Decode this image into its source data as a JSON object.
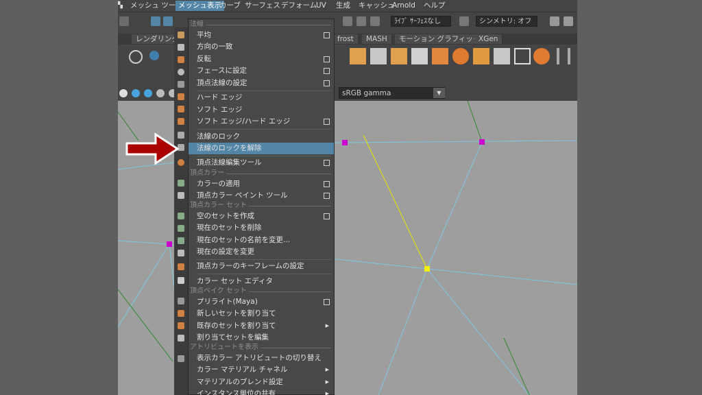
{
  "menubar": {
    "items": [
      "メッシュ ツール",
      "メッシュ表示",
      "カーブ",
      "サーフェス",
      "デフォーム",
      "UV",
      "生成",
      "キャッシュ",
      "Arnold",
      "ヘルプ"
    ],
    "active_index": 1
  },
  "toolbar": {
    "surface_field": "ﾗｲﾌﾞ ｻｰﾌｪｽなし",
    "symmetry_field": "シンメトリ: オフ"
  },
  "shelf_tabs": [
    "レンダリング",
    "frost",
    "MASH",
    "モーション グラフィックス",
    "XGen"
  ],
  "viewport": {
    "color_space": "sRGB gamma"
  },
  "menu": {
    "sections": [
      {
        "title": "法線",
        "items": [
          {
            "label": "平均",
            "option": true
          },
          {
            "label": "方向の一致",
            "option": false
          },
          {
            "label": "反転",
            "option": true
          },
          {
            "label": "フェースに設定",
            "option": true
          },
          {
            "label": "頂点法線の設定",
            "option": true
          },
          {
            "label": "ハード エッジ",
            "option": false
          },
          {
            "label": "ソフト エッジ",
            "option": false
          },
          {
            "label": "ソフト エッジ/ハード エッジ",
            "option": true
          },
          {
            "label": "法線のロック",
            "option": false
          },
          {
            "label": "法線のロックを解除",
            "option": false,
            "highlighted": true
          },
          {
            "label": "頂点法線編集ツール",
            "option": true
          }
        ]
      },
      {
        "title": "頂点カラー",
        "items": [
          {
            "label": "カラーの適用",
            "option": true
          },
          {
            "label": "頂点カラー ペイント ツール",
            "option": true
          }
        ]
      },
      {
        "title": "頂点カラー セット",
        "items": [
          {
            "label": "空のセットを作成",
            "option": true
          },
          {
            "label": "現在のセットを削除",
            "option": false
          },
          {
            "label": "現在のセットの名前を変更...",
            "option": false
          },
          {
            "label": "現在の設定を変更",
            "option": false
          },
          {
            "label": "頂点カラーのキーフレームの設定",
            "option": false
          },
          {
            "label": "カラー セット エディタ",
            "option": false
          }
        ]
      },
      {
        "title": "頂点ベイク セット",
        "items": [
          {
            "label": "プリライト(Maya)",
            "option": true
          },
          {
            "label": "新しいセットを割り当て",
            "option": false
          },
          {
            "label": "既存のセットを割り当て",
            "submenu": true
          },
          {
            "label": "割り当てセットを編集",
            "option": false
          }
        ]
      },
      {
        "title": "アトリビュートを表示",
        "items": [
          {
            "label": "表示カラー アトリビュートの切り替え",
            "option": false
          },
          {
            "label": "カラー マテリアル チャネル",
            "submenu": true
          },
          {
            "label": "マテリアルのブレンド設定",
            "submenu": true
          },
          {
            "label": "インスタンス単位の共有",
            "submenu": true
          }
        ]
      }
    ]
  },
  "colors": {
    "highlight": "#5285a6",
    "viewport_bg": "#9e9e9e",
    "wire_blue": "#7ec8e3",
    "wire_green": "#2d8a2d",
    "wire_yellow": "#e8e800",
    "vertex_magenta": "#cc00cc",
    "vertex_yellow": "#f0f000",
    "arrow_red": "#aa0000"
  },
  "annotation": {
    "icon": "red-arrow-icon"
  }
}
